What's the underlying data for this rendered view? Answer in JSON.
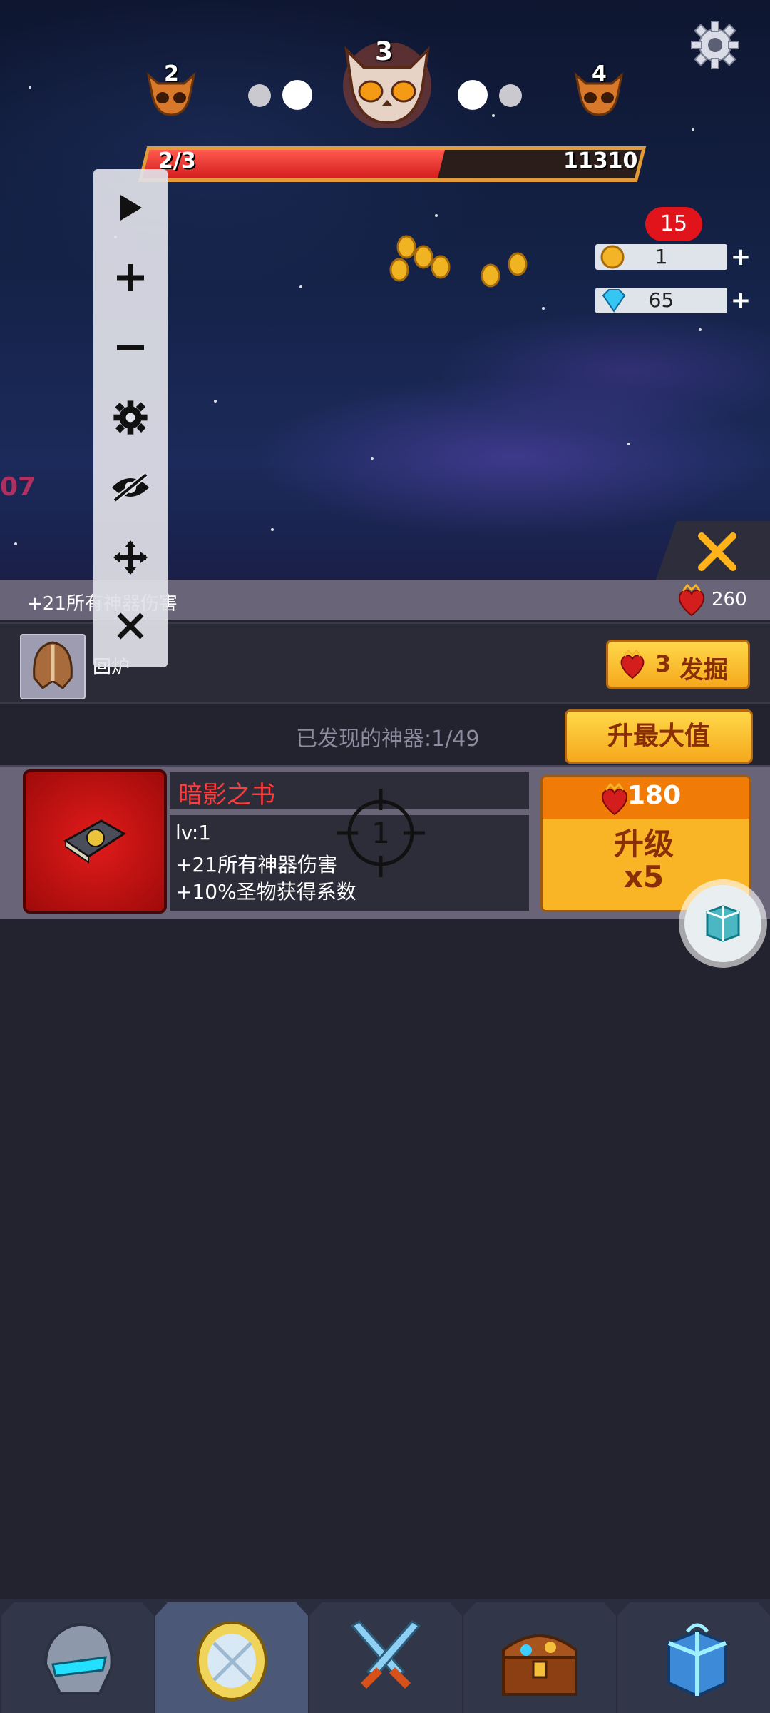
{
  "stages": {
    "prev": "2",
    "current": "3",
    "next": "4"
  },
  "hp": {
    "wave": "2/3",
    "value": "11310",
    "fill_fraction": 0.6
  },
  "currency": {
    "badge": "15",
    "coins": "1",
    "gems": "65",
    "plus": "+"
  },
  "info_strip": {
    "text": "+21所有神器伤害",
    "relic_count": "260"
  },
  "furnace": {
    "label": "回炉",
    "dig_count": "3",
    "dig_label": "发掘"
  },
  "discovery": {
    "text": "已发现的神器:1/49",
    "max_button": "升最大值"
  },
  "artifact": {
    "name": "暗影之书",
    "level": "lv:1",
    "effect1": "+21所有神器伤害",
    "effect2": "+10%圣物获得系数",
    "cost": "180",
    "upgrade_line1": "升级",
    "upgrade_line2": "x5"
  },
  "overlay": {
    "left_edge_text": "07",
    "crosshair_number": "1"
  },
  "colors": {
    "accent_orange": "#f07b06",
    "button_gold": "#f9b526",
    "hp_red": "#d41d1d",
    "panel_dark": "#23232f",
    "strip": "#6a6478"
  },
  "icons": [
    "skull-icon",
    "gear-icon",
    "coin-icon",
    "gem-icon",
    "play-icon",
    "plus-icon",
    "minus-icon",
    "eye-off-icon",
    "move-icon",
    "close-icon",
    "relic-heart-icon",
    "cube-icon",
    "helmet-icon",
    "orb-icon",
    "swords-icon",
    "chest-icon",
    "gift-icon"
  ]
}
